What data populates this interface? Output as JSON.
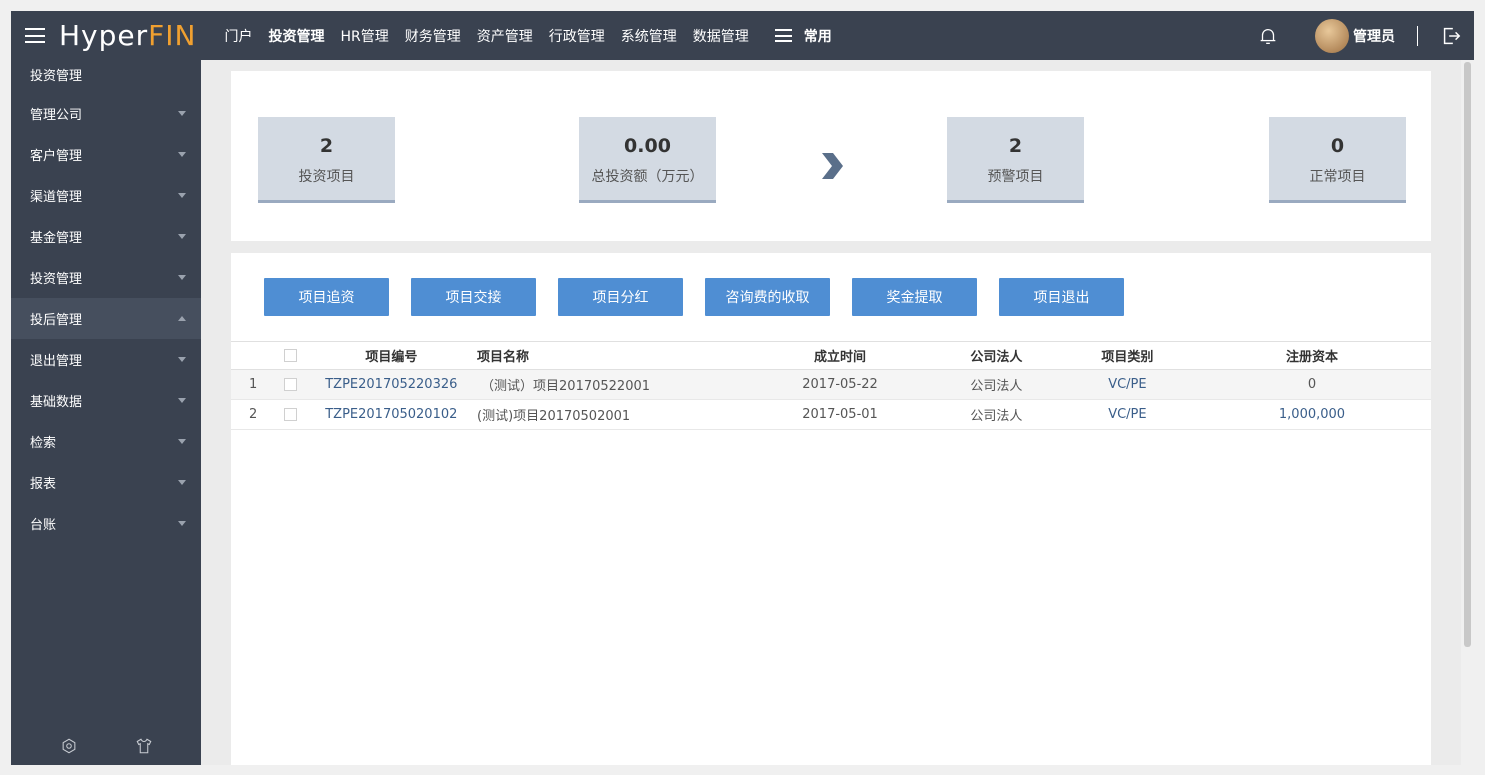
{
  "header": {
    "logo_part1": "Hyper",
    "logo_part2": "FIN",
    "nav": [
      "门户",
      "投资管理",
      "HR管理",
      "财务管理",
      "资产管理",
      "行政管理",
      "系统管理",
      "数据管理"
    ],
    "active_nav": "投资管理",
    "changyong": "常用",
    "username": "管理员"
  },
  "sidebar": {
    "title": "投资管理",
    "items": [
      {
        "label": "管理公司",
        "open": false
      },
      {
        "label": "客户管理",
        "open": false
      },
      {
        "label": "渠道管理",
        "open": false
      },
      {
        "label": "基金管理",
        "open": false
      },
      {
        "label": "投资管理",
        "open": false
      },
      {
        "label": "投后管理",
        "open": true
      },
      {
        "label": "退出管理",
        "open": false
      },
      {
        "label": "基础数据",
        "open": false
      },
      {
        "label": "检索",
        "open": false
      },
      {
        "label": "报表",
        "open": false
      },
      {
        "label": "台账",
        "open": false
      }
    ]
  },
  "stats": [
    {
      "value": "2",
      "label": "投资项目"
    },
    {
      "value": "0.00",
      "label": "总投资额（万元）"
    },
    {
      "value": "2",
      "label": "预警项目"
    },
    {
      "value": "0",
      "label": "正常项目"
    }
  ],
  "buttons": [
    "项目追资",
    "项目交接",
    "项目分红",
    "咨询费的收取",
    "奖金提取",
    "项目退出"
  ],
  "table": {
    "columns": [
      "项目编号",
      "项目名称",
      "成立时间",
      "公司法人",
      "项目类别",
      "注册资本"
    ],
    "rows": [
      {
        "index": "1",
        "code": "TZPE201705220326",
        "name": "（测试）项目20170522001",
        "date": "2017-05-22",
        "legal": "公司法人",
        "type": "VC/PE",
        "capital": "0"
      },
      {
        "index": "2",
        "code": "TZPE201705020102",
        "name": "(测试)项目20170502001",
        "date": "2017-05-01",
        "legal": "公司法人",
        "type": "VC/PE",
        "capital": "1,000,000"
      }
    ]
  },
  "colors": {
    "topbar": "#3a4250",
    "logo_accent": "#f0a030",
    "button": "#4f8ed3",
    "stat_card": "#d3dae3"
  }
}
